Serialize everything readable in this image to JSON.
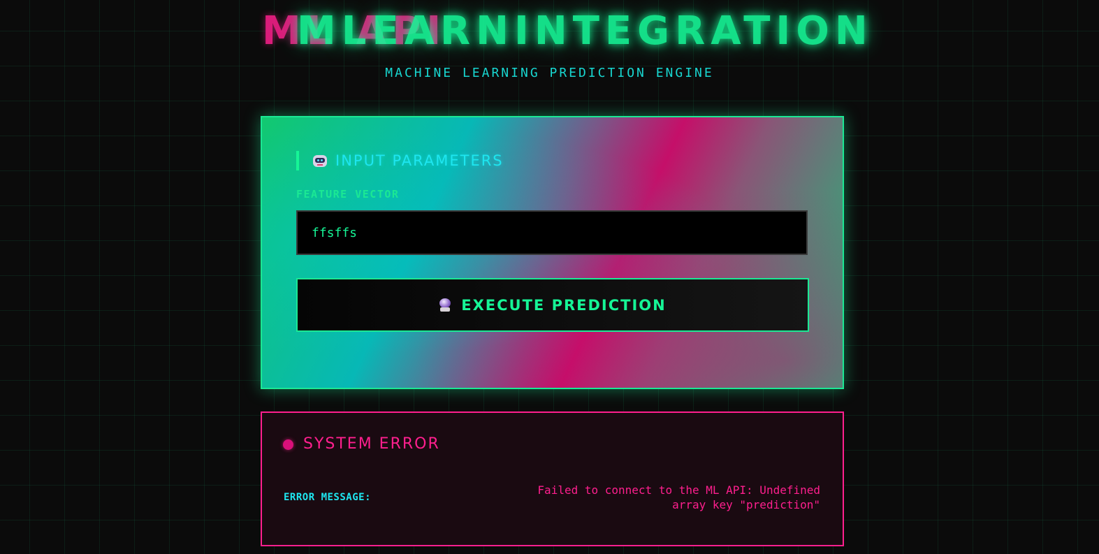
{
  "header": {
    "title_back": "ML API",
    "title_front": "MLEARNINTEGRATION",
    "subtitle": "MACHINE LEARNING PREDICTION ENGINE"
  },
  "input_panel": {
    "heading_icon": "robot-icon",
    "heading": "INPUT PARAMETERS",
    "field_label": "FEATURE VECTOR",
    "field_value": "ffsffs",
    "button_icon": "crystal-ball-icon",
    "button_label": "EXECUTE PREDICTION"
  },
  "error_panel": {
    "title": "SYSTEM ERROR",
    "label": "ERROR MESSAGE:",
    "message": "Failed to connect to the ML API: Undefined array key \"prediction\""
  },
  "colors": {
    "background": "#0b0b0b",
    "accent_green": "#16f596",
    "accent_pink": "#ff1f8e",
    "accent_cyan": "#1ee6f0"
  }
}
